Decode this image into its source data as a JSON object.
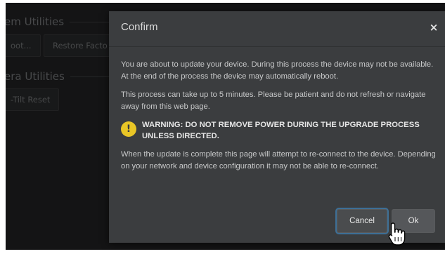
{
  "background": {
    "section1_title": "em Utilities",
    "section1_buttons": [
      "oot...",
      "Restore Facto"
    ],
    "section2_title": "era Utilities",
    "section2_buttons": [
      "-Tilt Reset"
    ]
  },
  "modal": {
    "title": "Confirm",
    "close_icon": "×",
    "paragraph1": "You are about to update your device. During this process the device may not be available. At the end of the process the device may automatically reboot.",
    "paragraph2": "This process can take up to 5 minutes. Please be patient and do not refresh or navigate away from this web page.",
    "warning_icon": "!",
    "warning_text": "WARNING: DO NOT REMOVE POWER DURING THE UPGRADE PROCESS UNLESS DIRECTED.",
    "paragraph3": "When the update is complete this page will attempt to re-connect to the device. Depending on your network and device configuration it may not be able to re-connect.",
    "cancel_label": "Cancel",
    "ok_label": "Ok"
  },
  "colors": {
    "modal_bg": "#3b3d3f",
    "warning_icon": "#e9c626",
    "focus_ring": "#3d6f96"
  },
  "icons": {
    "close": "close-icon",
    "warning": "warning-icon",
    "cursor": "hand-pointer-cursor-icon"
  }
}
